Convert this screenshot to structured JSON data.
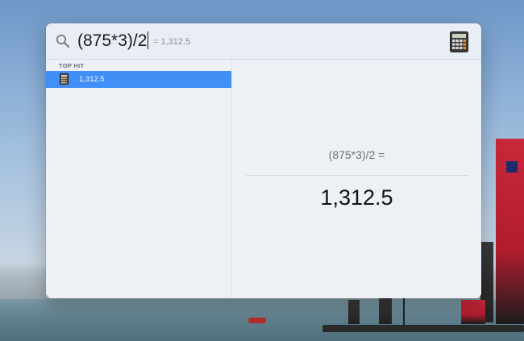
{
  "search": {
    "query": "(875*3)/2",
    "inline_result": "= 1,312.5"
  },
  "results": {
    "section_header": "TOP HIT",
    "top_hit_label": "1,312.5"
  },
  "preview": {
    "expression": "(875*3)/2 =",
    "result": "1,312.5"
  },
  "colors": {
    "selection": "#3f8ff7",
    "panel": "#edf0f5"
  },
  "icons": {
    "search": "search-icon",
    "app": "calculator-icon"
  }
}
